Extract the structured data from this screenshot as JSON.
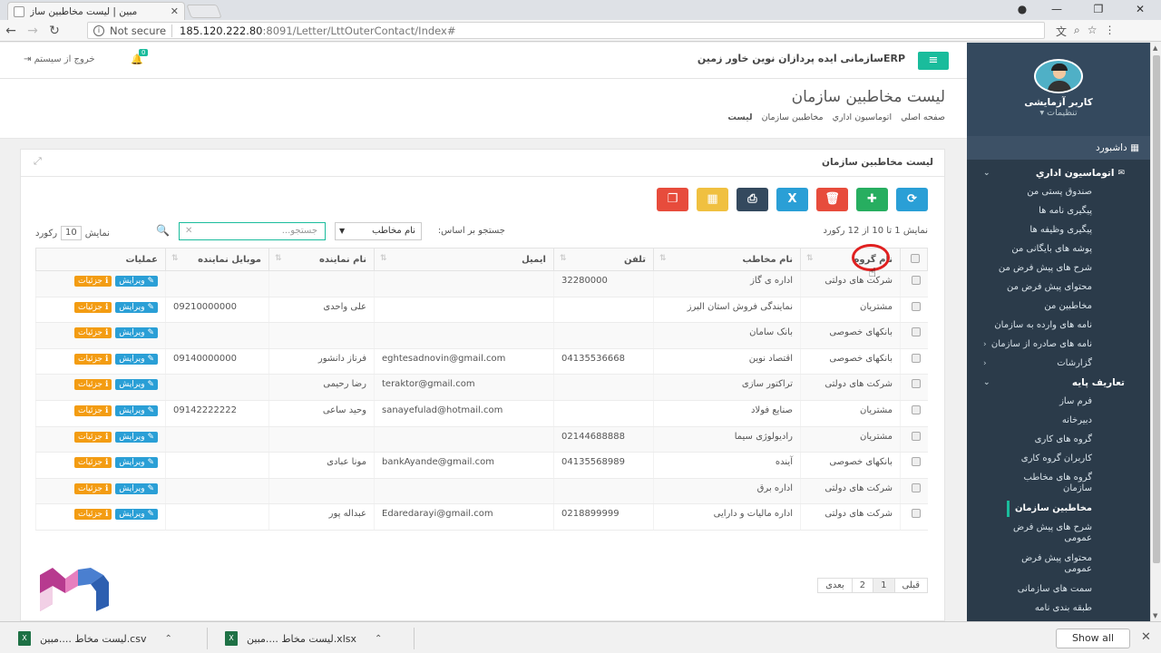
{
  "browser": {
    "tab_title": "مبین | لیست مخاطبین ساز",
    "not_secure": "Not secure",
    "url_host": "185.120.222.80",
    "url_path": ":8091/Letter/LttOuterContact/Index#"
  },
  "header": {
    "org_title": "ERPسازمانی ایده پردازان نوین خاور زمین",
    "notif_count": "0",
    "logout_label": "خروج از سیستم"
  },
  "page": {
    "title": "لیست مخاطبین سازمان",
    "breadcrumb": [
      "صفحه اصلي",
      "اتوماسيون اداري",
      "مخاطبین سازمان",
      "لیست"
    ]
  },
  "panel": {
    "title": "لیست مخاطبین سازمان",
    "showing": "نمایش 1 تا 10 از 12 رکورد",
    "search_by": "جستجو بر اساس:",
    "search_field": "نام مخاطب",
    "search_placeholder": "جستجو...",
    "per_page_prefix": "نمایش",
    "per_page_value": "10",
    "per_page_suffix": "رکورد"
  },
  "table": {
    "headers": [
      "نام گروه",
      "نام مخاطب",
      "تلفن",
      "ایمیل",
      "نام نماینده",
      "موبایل نماینده",
      "عملیات"
    ],
    "edit_label": "ویرایش",
    "details_label": "جزئیات",
    "rows": [
      {
        "group": "شرکت های دولتی",
        "name": "اداره ی گاز",
        "phone": "32280000",
        "email": "",
        "rep": "",
        "mobile": ""
      },
      {
        "group": "مشتریان",
        "name": "نمایندگی فروش استان البرز",
        "phone": "",
        "email": "",
        "rep": "علی واحدی",
        "mobile": "09210000000"
      },
      {
        "group": "بانکهای خصوصی",
        "name": "بانک سامان",
        "phone": "",
        "email": "",
        "rep": "",
        "mobile": ""
      },
      {
        "group": "بانکهای خصوصی",
        "name": "اقتصاد نوین",
        "phone": "04135536668",
        "email": "eghtesadnovin@gmail.com",
        "rep": "فرناز دانشور",
        "mobile": "09140000000"
      },
      {
        "group": "شرکت های دولتی",
        "name": "تراکتور سازی",
        "phone": "",
        "email": "teraktor@gmail.com",
        "rep": "رضا رحیمی",
        "mobile": ""
      },
      {
        "group": "مشتریان",
        "name": "صنایع فولاد",
        "phone": "",
        "email": "sanayefulad@hotmail.com",
        "rep": "وحید ساعی",
        "mobile": "09142222222"
      },
      {
        "group": "مشتریان",
        "name": "رادیولوژی سیما",
        "phone": "02144688888",
        "email": "",
        "rep": "",
        "mobile": ""
      },
      {
        "group": "بانکهای خصوصی",
        "name": "آینده",
        "phone": "04135568989",
        "email": "bankAyande@gmail.com",
        "rep": "مونا عبادی",
        "mobile": ""
      },
      {
        "group": "شرکت های دولتی",
        "name": "اداره برق",
        "phone": "",
        "email": "",
        "rep": "",
        "mobile": ""
      },
      {
        "group": "شرکت های دولتی",
        "name": "اداره مالیات و دارایی",
        "phone": "0218899999",
        "email": "Edaredarayi@gmail.com",
        "rep": "عبداله پور",
        "mobile": ""
      }
    ]
  },
  "pager": {
    "prev": "قبلی",
    "pages": [
      "1",
      "2"
    ],
    "next": "بعدی"
  },
  "sidebar": {
    "username": "کاربر آزمایشی",
    "settings": "تنظیمات",
    "dashboard": "داشبورد",
    "section1": "اتوماسیون اداري",
    "items1": [
      "صندوق پستی من",
      "پیگیری نامه ها",
      "پیگیری وظیفه ها",
      "پوشه های بایگانی من",
      "شرح های پیش فرض من",
      "محتوای پیش فرض من",
      "مخاطبین من",
      "نامه های وارده به سازمان",
      "نامه های صادره از سازمان",
      "گزارشات"
    ],
    "section2": "تعاریف پایه",
    "items2": [
      "فرم ساز",
      "دبیرخانه",
      "گروه های کاری",
      "کاربران گروه کاری",
      "گروه های مخاطب سازمان",
      "مخاطبین سازمان",
      "شرح های پیش فرض عمومی",
      "محتوای پیش فرض عمومی",
      "سمت های سازمانی",
      "طبقه بندی نامه"
    ]
  },
  "downloads": {
    "items": [
      "لیست مخاط ....مبین.csv",
      "لیست مخاط ....مبین.xlsx"
    ],
    "show_all": "Show all"
  }
}
